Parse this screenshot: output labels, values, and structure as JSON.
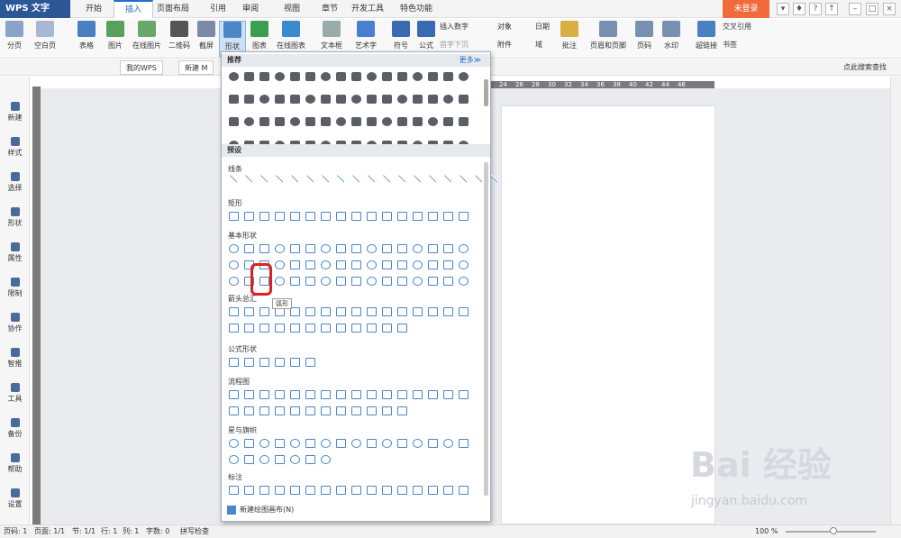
{
  "app_title": "WPS 文字",
  "tabs": [
    "开始",
    "插入",
    "页面布局",
    "引用",
    "审阅",
    "视图",
    "章节",
    "开发工具",
    "特色功能"
  ],
  "login": "未登录",
  "ribbon": {
    "blank_page": "分页",
    "empty_page": "空白页",
    "table": "表格",
    "picture": "图片",
    "online_pic": "在线图片",
    "qrcode": "二维码",
    "screenshot": "截屏",
    "shape": "形状",
    "chart": "图表",
    "online_chart": "在线图表",
    "textbox": "文本框",
    "arttext": "艺术字",
    "symbol": "符号",
    "formula": "公式",
    "insert_number": "插入数字",
    "first_drop": "首字下沉",
    "object": "对象",
    "attachment": "附件",
    "date": "日期",
    "field": "域",
    "comment": "批注",
    "header_footer": "页眉和页脚",
    "page_no": "页码",
    "watermark": "水印",
    "hyperlink": "超链接",
    "cross_ref": "交叉引用",
    "bookmark": "书签"
  },
  "doc_tabs": [
    "我的WPS",
    "新建 M"
  ],
  "search_placeholder": "点此搜索查找",
  "sidebar": [
    "新建",
    "样式",
    "选择",
    "形状",
    "属性",
    "限制",
    "协作",
    "智推",
    "工具",
    "备份",
    "帮助",
    "设置"
  ],
  "panel": {
    "recommended": "推荐",
    "more": "更多≫",
    "preset": "预设",
    "groups": [
      "线条",
      "矩形",
      "基本形状",
      "箭头总汇",
      "公式形状",
      "流程图",
      "星与旗帜",
      "标注"
    ],
    "tooltip": "弧形",
    "new_canvas": "新建绘图画布(N)"
  },
  "ruler_labels": [
    "24",
    "26",
    "28",
    "30",
    "32",
    "34",
    "36",
    "38",
    "40",
    "42",
    "44",
    "46"
  ],
  "status": {
    "page": "页码: 1",
    "pages": "页面: 1/1",
    "section": "节: 1/1",
    "row": "行: 1",
    "col": "列: 1",
    "words": "字数: 0",
    "spell": "拼写检查",
    "zoom": "100 %"
  },
  "watermark": "Bai 经验",
  "watermark_sub": "jingyan.baidu.com"
}
